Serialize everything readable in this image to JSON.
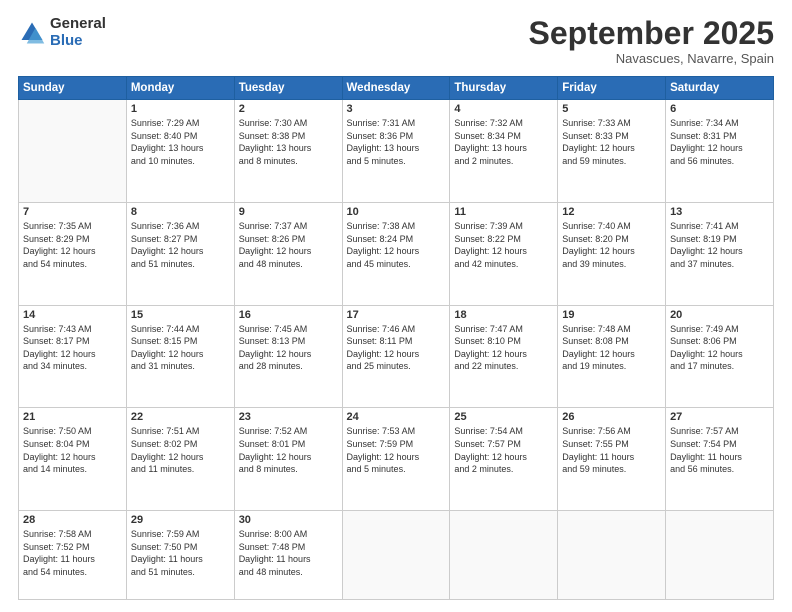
{
  "logo": {
    "general": "General",
    "blue": "Blue"
  },
  "header": {
    "month": "September 2025",
    "location": "Navascues, Navarre, Spain"
  },
  "weekdays": [
    "Sunday",
    "Monday",
    "Tuesday",
    "Wednesday",
    "Thursday",
    "Friday",
    "Saturday"
  ],
  "weeks": [
    [
      {
        "day": "",
        "info": ""
      },
      {
        "day": "1",
        "info": "Sunrise: 7:29 AM\nSunset: 8:40 PM\nDaylight: 13 hours\nand 10 minutes."
      },
      {
        "day": "2",
        "info": "Sunrise: 7:30 AM\nSunset: 8:38 PM\nDaylight: 13 hours\nand 8 minutes."
      },
      {
        "day": "3",
        "info": "Sunrise: 7:31 AM\nSunset: 8:36 PM\nDaylight: 13 hours\nand 5 minutes."
      },
      {
        "day": "4",
        "info": "Sunrise: 7:32 AM\nSunset: 8:34 PM\nDaylight: 13 hours\nand 2 minutes."
      },
      {
        "day": "5",
        "info": "Sunrise: 7:33 AM\nSunset: 8:33 PM\nDaylight: 12 hours\nand 59 minutes."
      },
      {
        "day": "6",
        "info": "Sunrise: 7:34 AM\nSunset: 8:31 PM\nDaylight: 12 hours\nand 56 minutes."
      }
    ],
    [
      {
        "day": "7",
        "info": "Sunrise: 7:35 AM\nSunset: 8:29 PM\nDaylight: 12 hours\nand 54 minutes."
      },
      {
        "day": "8",
        "info": "Sunrise: 7:36 AM\nSunset: 8:27 PM\nDaylight: 12 hours\nand 51 minutes."
      },
      {
        "day": "9",
        "info": "Sunrise: 7:37 AM\nSunset: 8:26 PM\nDaylight: 12 hours\nand 48 minutes."
      },
      {
        "day": "10",
        "info": "Sunrise: 7:38 AM\nSunset: 8:24 PM\nDaylight: 12 hours\nand 45 minutes."
      },
      {
        "day": "11",
        "info": "Sunrise: 7:39 AM\nSunset: 8:22 PM\nDaylight: 12 hours\nand 42 minutes."
      },
      {
        "day": "12",
        "info": "Sunrise: 7:40 AM\nSunset: 8:20 PM\nDaylight: 12 hours\nand 39 minutes."
      },
      {
        "day": "13",
        "info": "Sunrise: 7:41 AM\nSunset: 8:19 PM\nDaylight: 12 hours\nand 37 minutes."
      }
    ],
    [
      {
        "day": "14",
        "info": "Sunrise: 7:43 AM\nSunset: 8:17 PM\nDaylight: 12 hours\nand 34 minutes."
      },
      {
        "day": "15",
        "info": "Sunrise: 7:44 AM\nSunset: 8:15 PM\nDaylight: 12 hours\nand 31 minutes."
      },
      {
        "day": "16",
        "info": "Sunrise: 7:45 AM\nSunset: 8:13 PM\nDaylight: 12 hours\nand 28 minutes."
      },
      {
        "day": "17",
        "info": "Sunrise: 7:46 AM\nSunset: 8:11 PM\nDaylight: 12 hours\nand 25 minutes."
      },
      {
        "day": "18",
        "info": "Sunrise: 7:47 AM\nSunset: 8:10 PM\nDaylight: 12 hours\nand 22 minutes."
      },
      {
        "day": "19",
        "info": "Sunrise: 7:48 AM\nSunset: 8:08 PM\nDaylight: 12 hours\nand 19 minutes."
      },
      {
        "day": "20",
        "info": "Sunrise: 7:49 AM\nSunset: 8:06 PM\nDaylight: 12 hours\nand 17 minutes."
      }
    ],
    [
      {
        "day": "21",
        "info": "Sunrise: 7:50 AM\nSunset: 8:04 PM\nDaylight: 12 hours\nand 14 minutes."
      },
      {
        "day": "22",
        "info": "Sunrise: 7:51 AM\nSunset: 8:02 PM\nDaylight: 12 hours\nand 11 minutes."
      },
      {
        "day": "23",
        "info": "Sunrise: 7:52 AM\nSunset: 8:01 PM\nDaylight: 12 hours\nand 8 minutes."
      },
      {
        "day": "24",
        "info": "Sunrise: 7:53 AM\nSunset: 7:59 PM\nDaylight: 12 hours\nand 5 minutes."
      },
      {
        "day": "25",
        "info": "Sunrise: 7:54 AM\nSunset: 7:57 PM\nDaylight: 12 hours\nand 2 minutes."
      },
      {
        "day": "26",
        "info": "Sunrise: 7:56 AM\nSunset: 7:55 PM\nDaylight: 11 hours\nand 59 minutes."
      },
      {
        "day": "27",
        "info": "Sunrise: 7:57 AM\nSunset: 7:54 PM\nDaylight: 11 hours\nand 56 minutes."
      }
    ],
    [
      {
        "day": "28",
        "info": "Sunrise: 7:58 AM\nSunset: 7:52 PM\nDaylight: 11 hours\nand 54 minutes."
      },
      {
        "day": "29",
        "info": "Sunrise: 7:59 AM\nSunset: 7:50 PM\nDaylight: 11 hours\nand 51 minutes."
      },
      {
        "day": "30",
        "info": "Sunrise: 8:00 AM\nSunset: 7:48 PM\nDaylight: 11 hours\nand 48 minutes."
      },
      {
        "day": "",
        "info": ""
      },
      {
        "day": "",
        "info": ""
      },
      {
        "day": "",
        "info": ""
      },
      {
        "day": "",
        "info": ""
      }
    ]
  ]
}
